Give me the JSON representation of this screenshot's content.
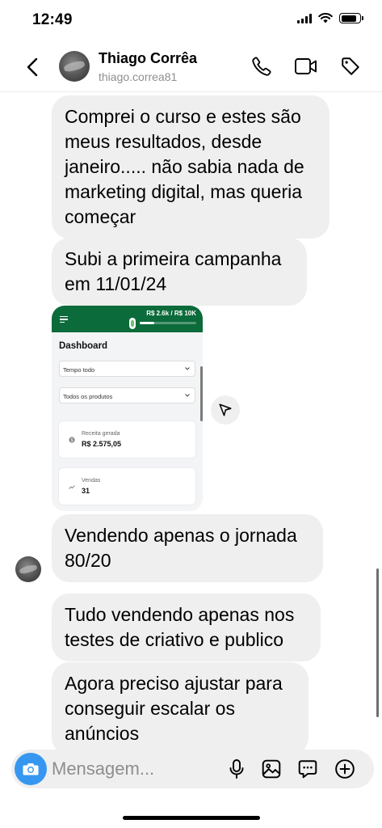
{
  "status_bar": {
    "time": "12:49",
    "battery_level": 0.85
  },
  "header": {
    "contact_name": "Thiago Corrêa",
    "username": "thiago.correa81",
    "icons": [
      "back-chevron-icon",
      "phone-icon",
      "video-call-icon",
      "tag-icon"
    ]
  },
  "messages": [
    {
      "text": "Comprei o curso e estes são meus resultados, desde janeiro..... não sabia nada de marketing digital, mas queria começar"
    },
    {
      "text": "Subi a primeira campanha em 11/01/24"
    },
    {
      "text": "Vendendo apenas o jornada 80/20"
    },
    {
      "text": "Tudo vendendo apenas nos testes de criativo e publico"
    },
    {
      "text": "Agora preciso ajustar para conseguir escalar os anúncios"
    }
  ],
  "image_message": {
    "goal_text": "R$ 2.6k / R$ 10K",
    "goal_progress": 0.26,
    "title": "Dashboard",
    "filter_period": "Tempo todo",
    "filter_products": "Todos os produtos",
    "revenue_label": "Receita gerada",
    "revenue_value": "R$  2.575,05",
    "sales_label": "Vendas",
    "sales_value": "31"
  },
  "composer": {
    "placeholder": "Mensagem...",
    "accent_color": "#3797f0"
  },
  "colors": {
    "bubble_bg": "#efefef",
    "dashboard_green": "#0b6b3a"
  }
}
